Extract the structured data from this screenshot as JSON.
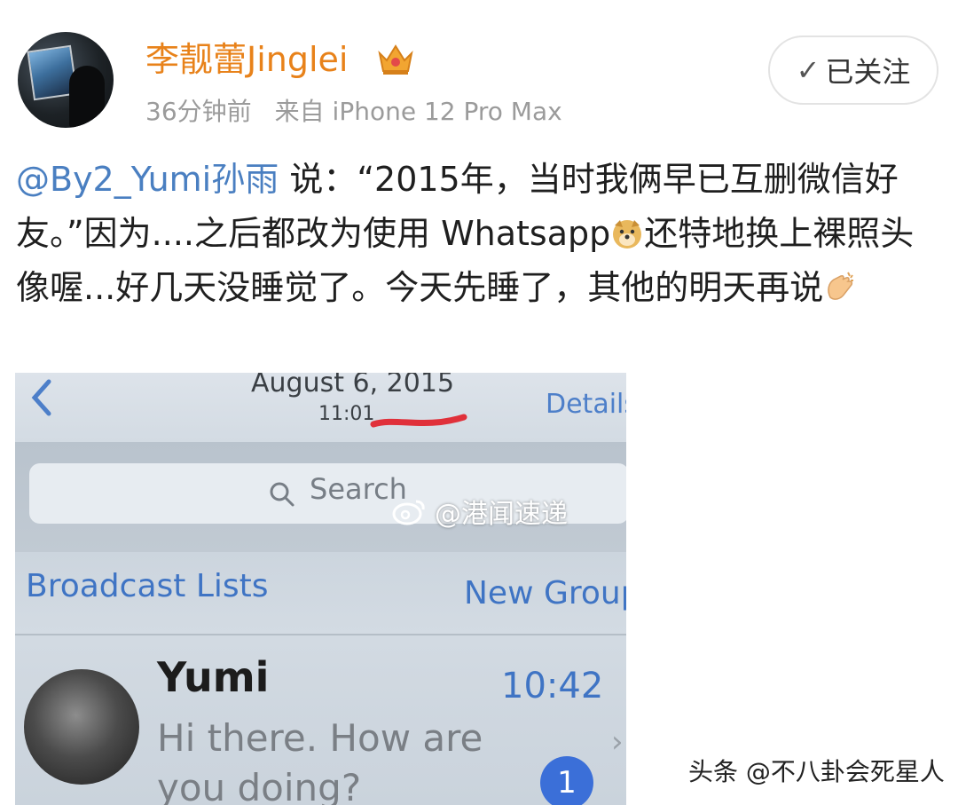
{
  "post": {
    "author": "李靓蕾Jinglei",
    "time_ago": "36分钟前",
    "source": "来自 iPhone 12 Pro Max",
    "follow_label": "已关注",
    "mention": "@By2_Yumi孙雨",
    "text_part1": " 说：“2015年，当时我俩早已互删微信好友。”因为....之后都改为使用 Whatsapp",
    "text_part2": "还特地换上裸照头像喔...好几天没睡觉了。今天先睡了，其他的明天再说"
  },
  "photo": {
    "date": "August 6, 2015",
    "time": "11:01",
    "details": "Details",
    "search_placeholder": "Search",
    "watermark": "@港闻速递",
    "broadcast_lists": "Broadcast Lists",
    "new_group": "New Group",
    "chat": {
      "name": "Yumi",
      "time": "10:42",
      "preview": "Hi there. How are you doing?",
      "unread": "1"
    }
  },
  "credit": "头条 @不八卦会死星人",
  "colors": {
    "author": "#e8821a",
    "mention": "#4a7fc1",
    "ios_blue": "#3f74c4"
  },
  "icons": [
    "crown-icon",
    "check-icon",
    "doge-emoji",
    "clap-emoji",
    "back-chevron-icon",
    "search-icon",
    "weibo-icon",
    "chevron-right-icon"
  ]
}
